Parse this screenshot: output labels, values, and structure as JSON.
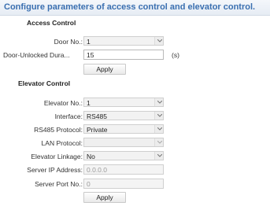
{
  "header": {
    "title": "Configure parameters of access control and elevator control."
  },
  "access_control": {
    "section_title": "Access Control",
    "door_no": {
      "label": "Door No.:",
      "value": "1"
    },
    "door_unlocked_duration": {
      "label": "Door-Unlocked Dura...",
      "value": "15",
      "unit": "(s)"
    },
    "apply_label": "Apply"
  },
  "elevator_control": {
    "section_title": "Elevator Control",
    "elevator_no": {
      "label": "Elevator No.:",
      "value": "1"
    },
    "interface": {
      "label": "Interface:",
      "value": "RS485"
    },
    "rs485_protocol": {
      "label": "RS485 Protocol:",
      "value": "Private"
    },
    "lan_protocol": {
      "label": "LAN Protocol:",
      "value": ""
    },
    "elevator_linkage": {
      "label": "Elevator Linkage:",
      "value": "No"
    },
    "server_ip": {
      "label": "Server IP Address:",
      "value": "0.0.0.0"
    },
    "server_port": {
      "label": "Server Port No.:",
      "value": "0"
    },
    "apply_label": "Apply"
  }
}
